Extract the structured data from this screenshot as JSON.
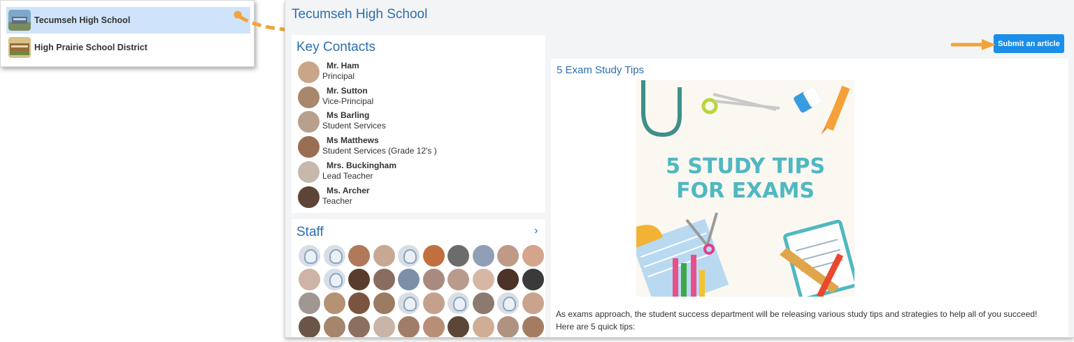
{
  "switcher": {
    "items": [
      {
        "label": "Tecumseh High School",
        "active": true
      },
      {
        "label": "High Prairie School District",
        "active": false
      }
    ]
  },
  "page": {
    "title": "Tecumseh High School"
  },
  "contacts": {
    "heading": "Key Contacts",
    "people": [
      {
        "name": "Mr. Ham",
        "role": "Principal",
        "avatar_color": "#c9a58a"
      },
      {
        "name": "Mr. Sutton",
        "role": "Vice-Principal",
        "avatar_color": "#a8876d"
      },
      {
        "name": "Ms Barling",
        "role": "Student Services",
        "avatar_color": "#b7a08e"
      },
      {
        "name": "Ms Matthews",
        "role": "Student Services (Grade 12's )",
        "avatar_color": "#9a6e52"
      },
      {
        "name": "Mrs. Buckingham",
        "role": "Lead Teacher",
        "avatar_color": "#c6b8ad"
      },
      {
        "name": "Ms. Archer",
        "role": "Teacher",
        "avatar_color": "#5e4436"
      }
    ]
  },
  "staff": {
    "heading": "Staff",
    "chevron": "chevron-right-icon",
    "avatars": [
      "placeholder",
      "placeholder",
      "#b0795a",
      "#c7a893",
      "placeholder",
      "#c0703e",
      "#6d6c6c",
      "#8f9fb6",
      "#bf9a86",
      "#d4a48b",
      "#cdb4a4",
      "placeholder",
      "#5a3c2c",
      "#8a6d60",
      "#7d8fa6",
      "#a98a7e",
      "#b89b8c",
      "#d6b7a3",
      "#4c3327",
      "#3a3a3a",
      "#a09793",
      "#b59274",
      "#7b5440",
      "#9c7b63",
      "placeholder",
      "#c4a18c",
      "placeholder",
      "#8c7a70",
      "placeholder",
      "#c9a38b",
      "#6a5548",
      "#a6856d",
      "#8d6f5e",
      "#c9b4a8",
      "#9f7d68",
      "#b98e76",
      "#5b4638",
      "#d0ad94",
      "#b09283",
      "#a37c62"
    ]
  },
  "toolbar": {
    "submit_label": "Submit an article"
  },
  "article": {
    "title": "5 Exam Study Tips",
    "hero_text_line1": "5 STUDY TIPS",
    "hero_text_line2": "FOR EXAMS",
    "body_line1": "As exams approach, the student success department will be releasing various study tips and strategies to help all of you succeed!",
    "body_line2": "Here are 5 quick tips:"
  },
  "colors": {
    "accent": "#2d6eae",
    "button": "#1a8ee8",
    "annotation_arrow": "#f2a33a",
    "hero_text": "#4fb8c2"
  }
}
